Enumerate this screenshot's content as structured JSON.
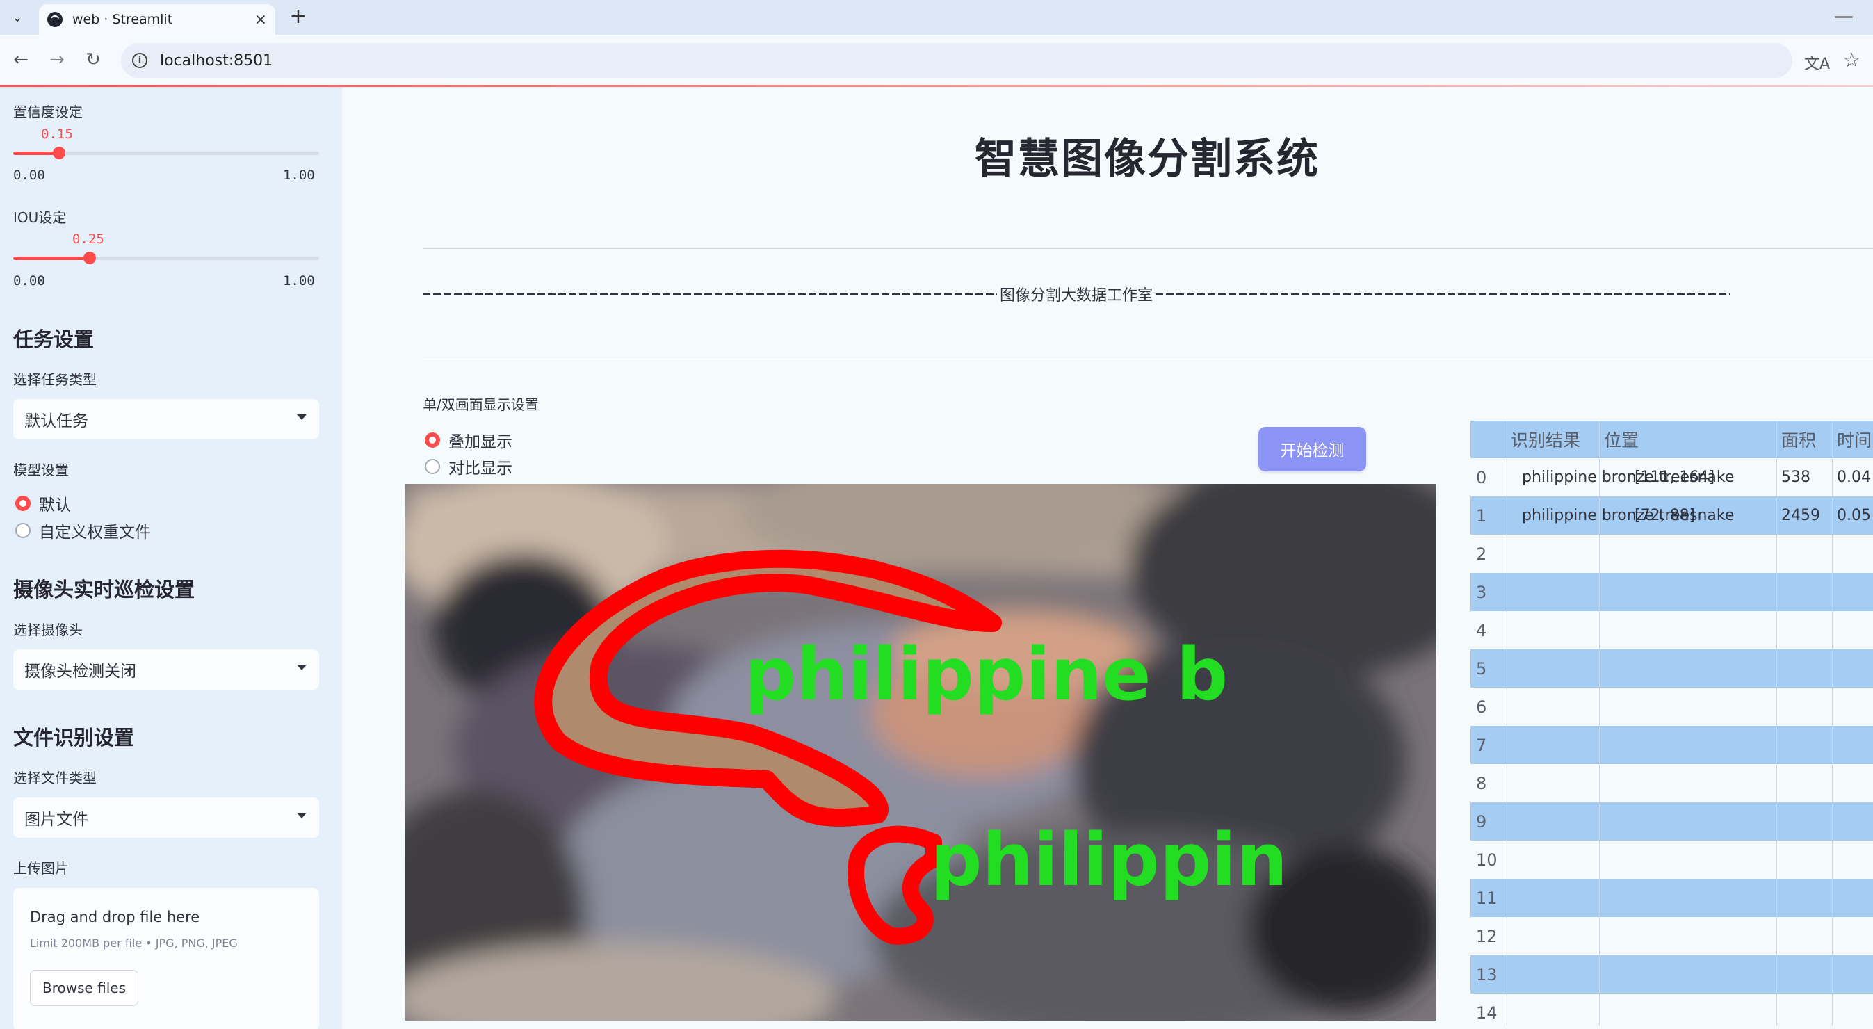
{
  "browser": {
    "tab_title": "web · Streamlit",
    "tab_close": "×",
    "new_tab": "+",
    "url": "localhost:8501",
    "minimize": "—"
  },
  "sidebar": {
    "confidence": {
      "label": "置信度设定",
      "value": "0.15",
      "min": "0.00",
      "max": "1.00",
      "fraction": 0.15
    },
    "iou": {
      "label": "IOU设定",
      "value": "0.25",
      "min": "0.00",
      "max": "1.00",
      "fraction": 0.25
    },
    "task_heading": "任务设置",
    "task_type_label": "选择任务类型",
    "task_type_value": "默认任务",
    "model_label": "模型设置",
    "model_options": [
      "默认",
      "自定义权重文件"
    ],
    "camera_heading": "摄像头实时巡检设置",
    "camera_label": "选择摄像头",
    "camera_value": "摄像头检测关闭",
    "file_heading": "文件识别设置",
    "file_type_label": "选择文件类型",
    "file_type_value": "图片文件",
    "upload_label": "上传图片",
    "upload_drag": "Drag and drop file here",
    "upload_limit": "Limit 200MB per file • JPG, PNG, JPEG",
    "upload_button": "Browse files"
  },
  "main": {
    "title": "智慧图像分割系统",
    "studio": "图像分割大数据工作室",
    "display_label": "单/双画面显示设置",
    "display_options": [
      "叠加显示",
      "对比显示"
    ],
    "detect_button": "开始检测",
    "overlay_labels": [
      "philippine b",
      "philippin"
    ]
  },
  "table": {
    "columns": [
      "识别结果",
      "位置",
      "面积",
      "时间"
    ],
    "rows": [
      {
        "idx": "0",
        "result": "philippine bronze treesnake",
        "position": "[111, 164]",
        "area": "538",
        "time": "0.04"
      },
      {
        "idx": "1",
        "result": "philippine bronze treesnake",
        "position": "[72, 88]",
        "area": "2459",
        "time": "0.05"
      },
      {
        "idx": "2"
      },
      {
        "idx": "3"
      },
      {
        "idx": "4"
      },
      {
        "idx": "5"
      },
      {
        "idx": "6"
      },
      {
        "idx": "7"
      },
      {
        "idx": "8"
      },
      {
        "idx": "9"
      },
      {
        "idx": "10"
      },
      {
        "idx": "11"
      },
      {
        "idx": "12"
      },
      {
        "idx": "13"
      },
      {
        "idx": "14"
      }
    ]
  },
  "colors": {
    "accent": "#ff4b4b",
    "button": "#8c94f6",
    "table_stripe": "#a5cdf3",
    "mask_red": "#ff0000",
    "label_green": "#22dd22"
  }
}
